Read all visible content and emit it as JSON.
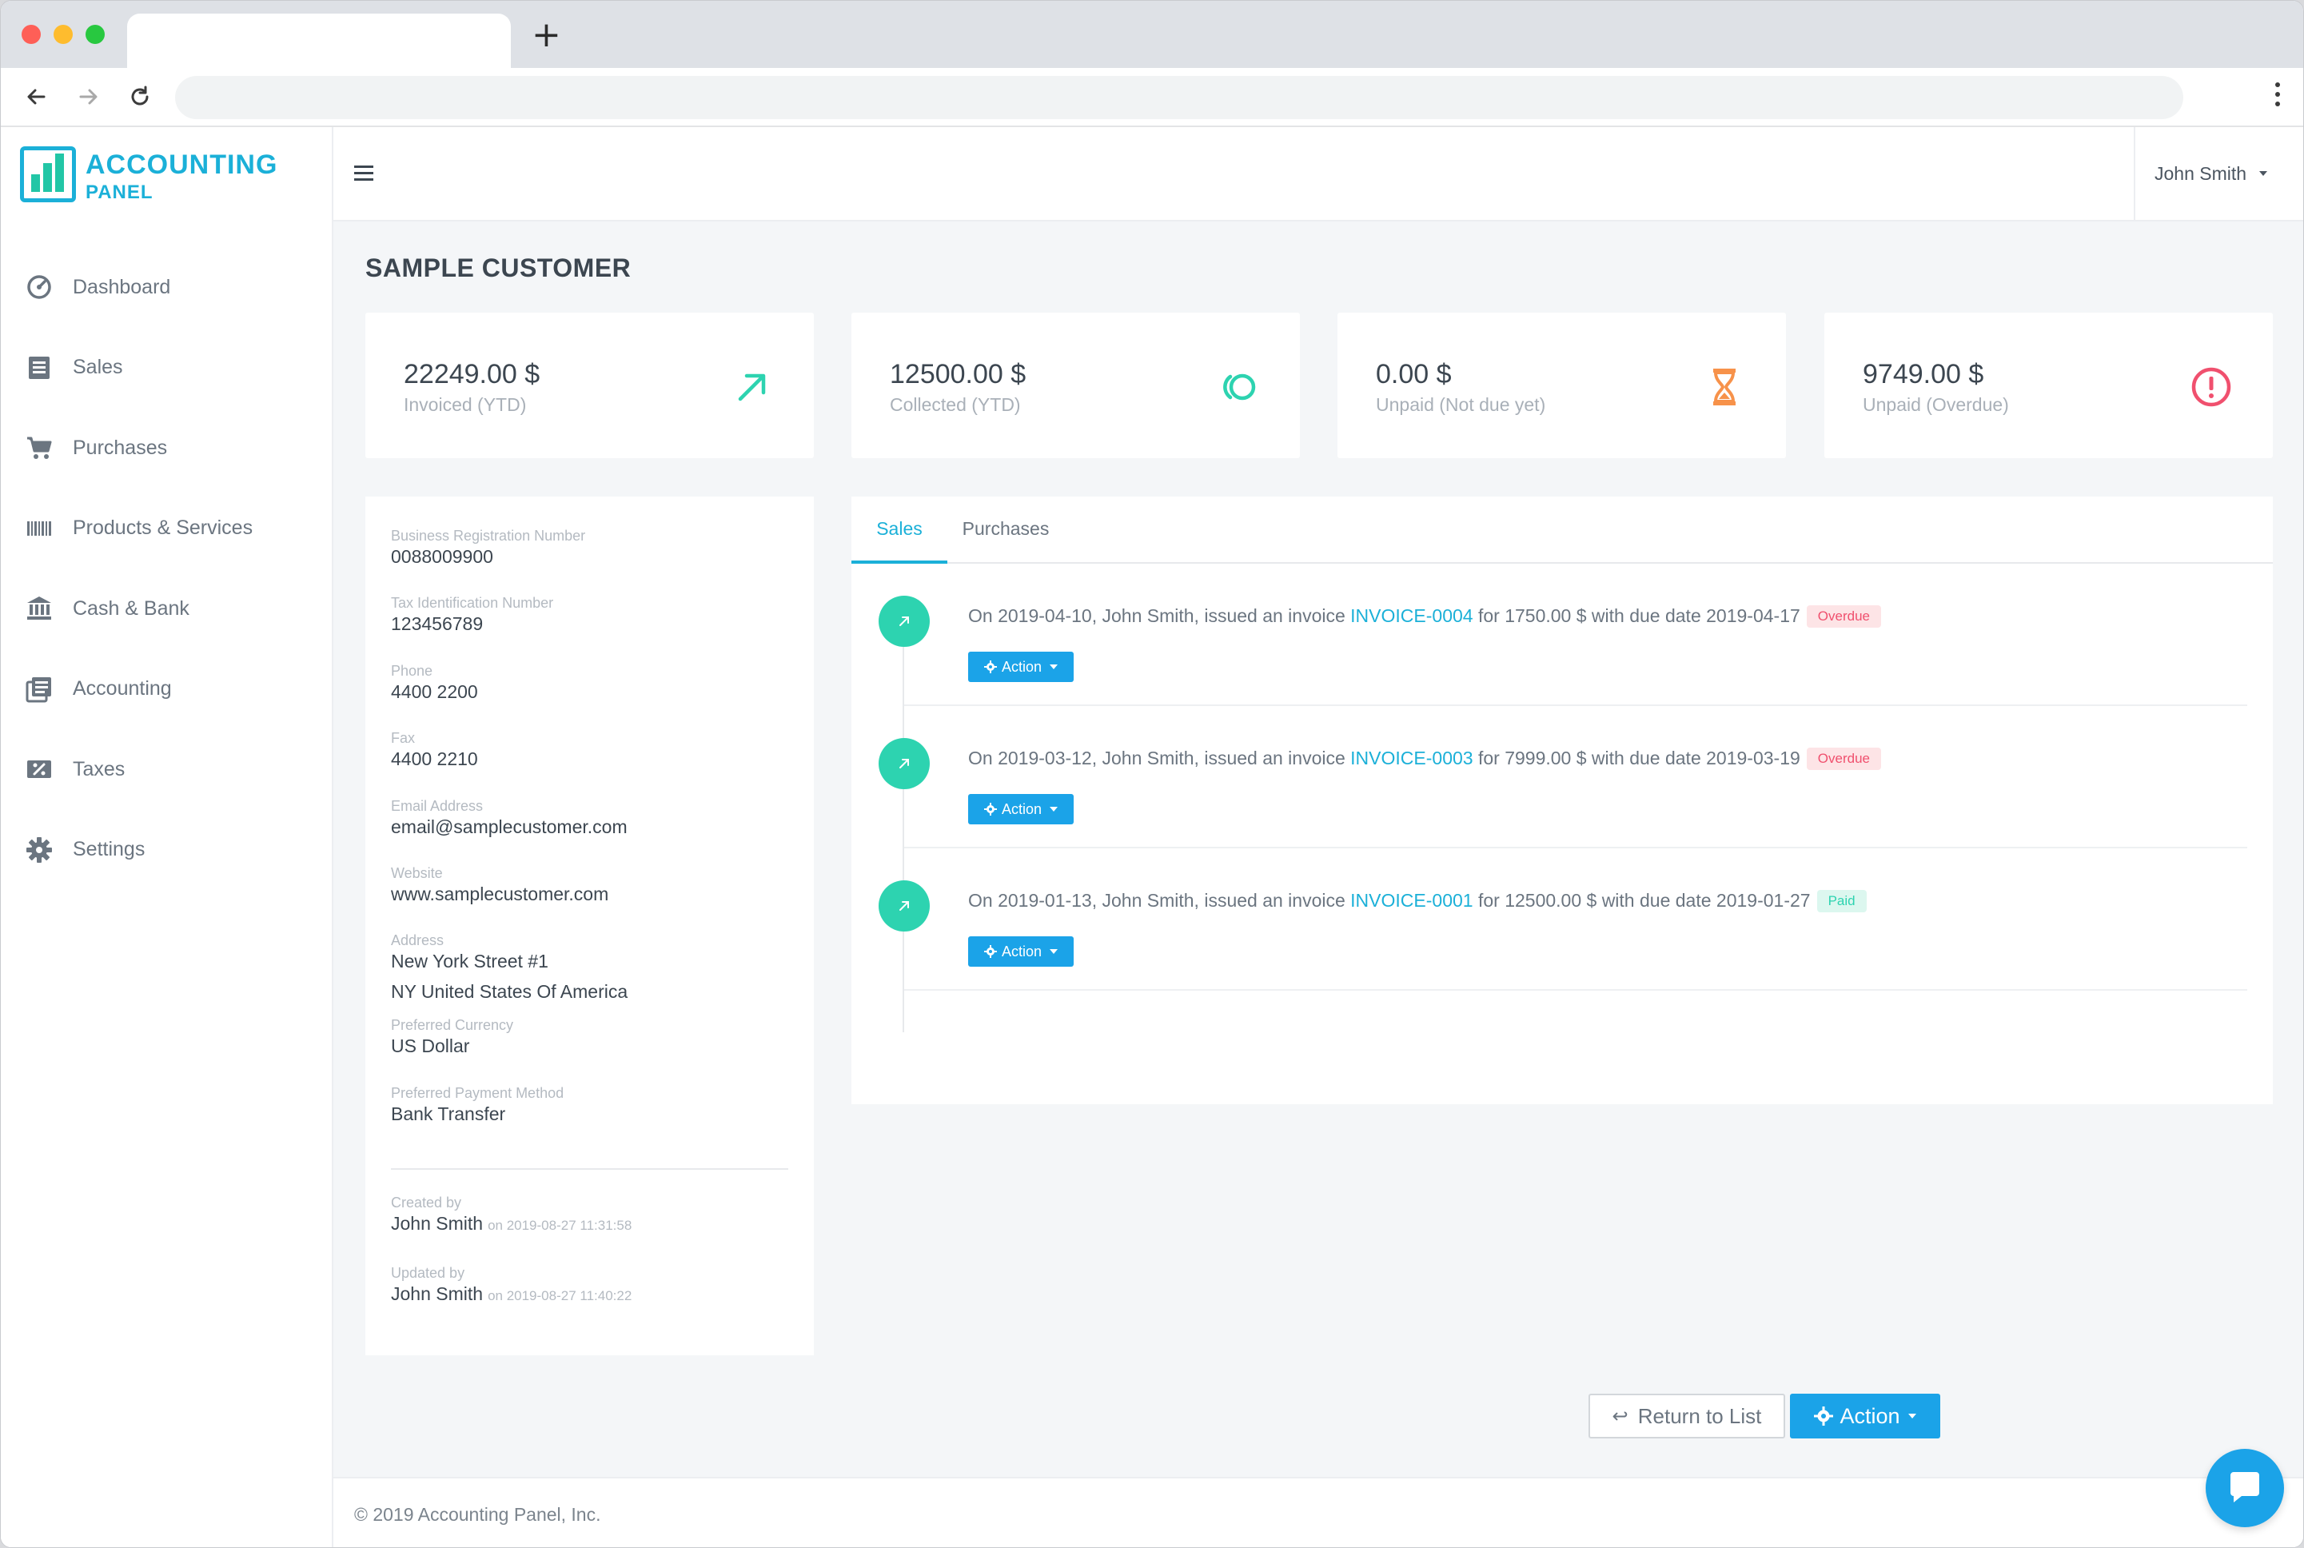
{
  "app": {
    "logo_line1": "ACCOUNTING",
    "logo_line2": "PANEL",
    "accent": "#1bb0d8",
    "teal": "#2dd3b0"
  },
  "sidebar": {
    "items": [
      {
        "label": "Dashboard",
        "icon": "speedometer-icon"
      },
      {
        "label": "Sales",
        "icon": "receipt-icon"
      },
      {
        "label": "Purchases",
        "icon": "cart-icon"
      },
      {
        "label": "Products & Services",
        "icon": "barcode-icon"
      },
      {
        "label": "Cash & Bank",
        "icon": "bank-icon"
      },
      {
        "label": "Accounting",
        "icon": "ledger-icon"
      },
      {
        "label": "Taxes",
        "icon": "percent-ticket-icon"
      },
      {
        "label": "Settings",
        "icon": "gear-icon"
      }
    ]
  },
  "topbar": {
    "user": "John Smith"
  },
  "page": {
    "title": "SAMPLE CUSTOMER"
  },
  "stats": [
    {
      "value": "22249.00 $",
      "label": "Invoiced (YTD)",
      "icon": "arrow-up-right-icon",
      "color": "#2dd3b0"
    },
    {
      "value": "12500.00 $",
      "label": "Collected (YTD)",
      "icon": "coins-icon",
      "color": "#2dd3b0"
    },
    {
      "value": "0.00 $",
      "label": "Unpaid (Not due yet)",
      "icon": "hourglass-icon",
      "color": "#f7924a"
    },
    {
      "value": "9749.00 $",
      "label": "Unpaid (Overdue)",
      "icon": "alert-circle-icon",
      "color": "#f0506e"
    }
  ],
  "customer": {
    "fields": [
      {
        "label": "Business Registration Number",
        "value": "0088009900"
      },
      {
        "label": "Tax Identification Number",
        "value": "123456789"
      },
      {
        "label": "Phone",
        "value": "4400 2200"
      },
      {
        "label": "Fax",
        "value": "4400 2210"
      },
      {
        "label": "Email Address",
        "value": "email@samplecustomer.com"
      },
      {
        "label": "Website",
        "value": "www.samplecustomer.com"
      },
      {
        "label": "Address",
        "value": "New York Street #1",
        "value2": "NY United States Of America"
      },
      {
        "label": "Preferred Currency",
        "value": "US Dollar"
      },
      {
        "label": "Preferred Payment Method",
        "value": "Bank Transfer"
      }
    ],
    "created": {
      "label": "Created by",
      "user": "John Smith",
      "meta": "on 2019-08-27 11:31:58"
    },
    "updated": {
      "label": "Updated by",
      "user": "John Smith",
      "meta": "on 2019-08-27 11:40:22"
    }
  },
  "tabs": [
    {
      "label": "Sales",
      "active": true
    },
    {
      "label": "Purchases",
      "active": false
    }
  ],
  "timeline": [
    {
      "pre": "On 2019-04-10, John Smith, issued an invoice ",
      "link": "INVOICE-0004",
      "post": " for 1750.00 $ with due date 2019-04-17",
      "status": "Overdue",
      "button": "Action"
    },
    {
      "pre": "On 2019-03-12, John Smith, issued an invoice ",
      "link": "INVOICE-0003",
      "post": " for 7999.00 $ with due date 2019-03-19",
      "status": "Overdue",
      "button": "Action"
    },
    {
      "pre": "On 2019-01-13, John Smith, issued an invoice ",
      "link": "INVOICE-0001",
      "post": " for 12500.00 $ with due date 2019-01-27",
      "status": "Paid",
      "button": "Action"
    }
  ],
  "actions": {
    "return_label": "Return to List",
    "action_label": "Action"
  },
  "footer": {
    "text": "© 2019 Accounting Panel, Inc."
  }
}
